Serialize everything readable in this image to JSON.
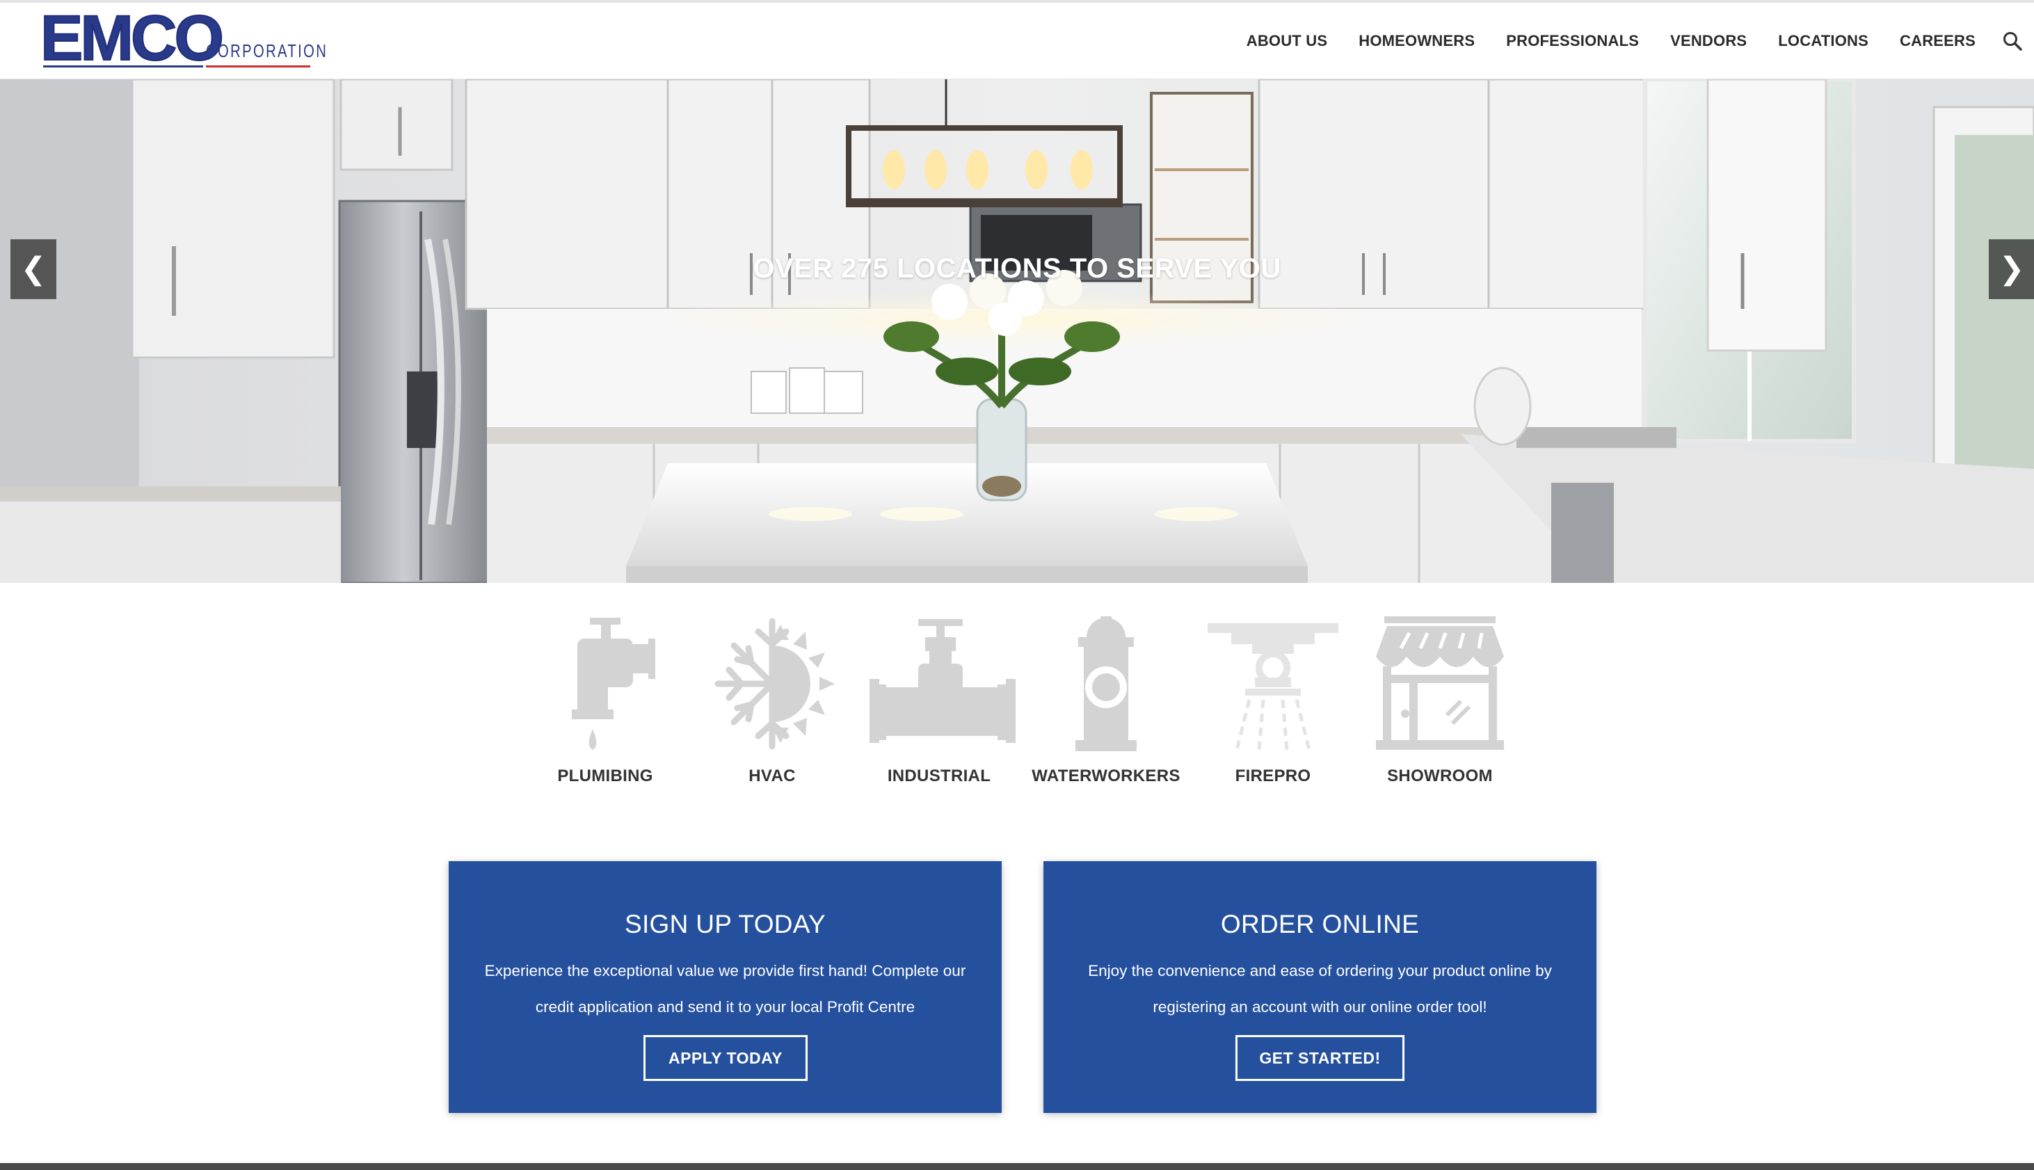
{
  "brand": {
    "name": "EMCO",
    "subtitle": "CORPORATION"
  },
  "nav": {
    "items": [
      "ABOUT US",
      "HOMEOWNERS",
      "PROFESSIONALS",
      "VENDORS",
      "LOCATIONS",
      "CAREERS"
    ],
    "search_icon": "search-icon"
  },
  "hero": {
    "caption": "OVER 275 LOCATIONS TO SERVE YOU",
    "prev_glyph": "❮",
    "next_glyph": "❯"
  },
  "categories": [
    {
      "label": "PLUMIBING",
      "icon": "faucet-icon"
    },
    {
      "label": "HVAC",
      "icon": "snowflake-sun-icon"
    },
    {
      "label": "INDUSTRIAL",
      "icon": "pipe-valve-icon"
    },
    {
      "label": "WATERWORKERS",
      "icon": "fire-hydrant-icon"
    },
    {
      "label": "FIREPRO",
      "icon": "sprinkler-icon"
    },
    {
      "label": "SHOWROOM",
      "icon": "storefront-icon"
    }
  ],
  "cards": {
    "signup": {
      "title": "SIGN UP TODAY",
      "text": "Experience the exceptional value we provide first hand! Complete our credit application and send it to your local Profit Centre",
      "button": "APPLY TODAY"
    },
    "order": {
      "title": "ORDER ONLINE",
      "text": "Enjoy the convenience and ease of ordering your product online by registering an account with our online order tool!",
      "button": "GET STARTED!"
    }
  },
  "colors": {
    "brand_blue": "#2a3a8a",
    "brand_red": "#c9302c",
    "card_blue": "#24509e",
    "icon_gray": "#d3d3d3"
  }
}
